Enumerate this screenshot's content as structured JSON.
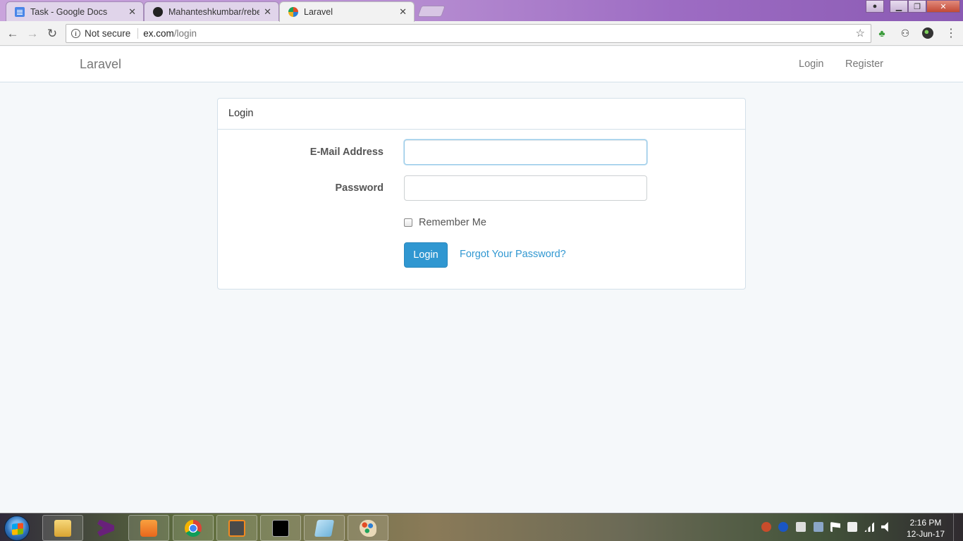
{
  "browser": {
    "tabs": [
      {
        "title": "Task - Google Docs",
        "icon": "google-docs-icon"
      },
      {
        "title": "Mahanteshkumbar/rebel",
        "icon": "github-icon"
      },
      {
        "title": "Laravel",
        "icon": "laravel-icon"
      }
    ],
    "security_label": "Not secure",
    "url_host": "ex.com",
    "url_path": "/login"
  },
  "app": {
    "brand": "Laravel",
    "nav": {
      "login": "Login",
      "register": "Register"
    }
  },
  "login_panel": {
    "heading": "Login",
    "email_label": "E-Mail Address",
    "email_value": "",
    "password_label": "Password",
    "password_value": "",
    "remember_label": "Remember Me",
    "remember_checked": false,
    "submit_label": "Login",
    "forgot_link": "Forgot Your Password?"
  },
  "taskbar": {
    "apps": [
      "file-explorer-icon",
      "visual-studio-icon",
      "media-player-icon",
      "chrome-icon",
      "sublime-text-icon",
      "command-prompt-icon",
      "notepad-icon",
      "paint-icon"
    ],
    "time": "2:16 PM",
    "date": "12-Jun-17"
  },
  "colors": {
    "primary": "#3097d1",
    "page_background": "#f5f8fa",
    "panel_border": "#d3e0e9"
  }
}
